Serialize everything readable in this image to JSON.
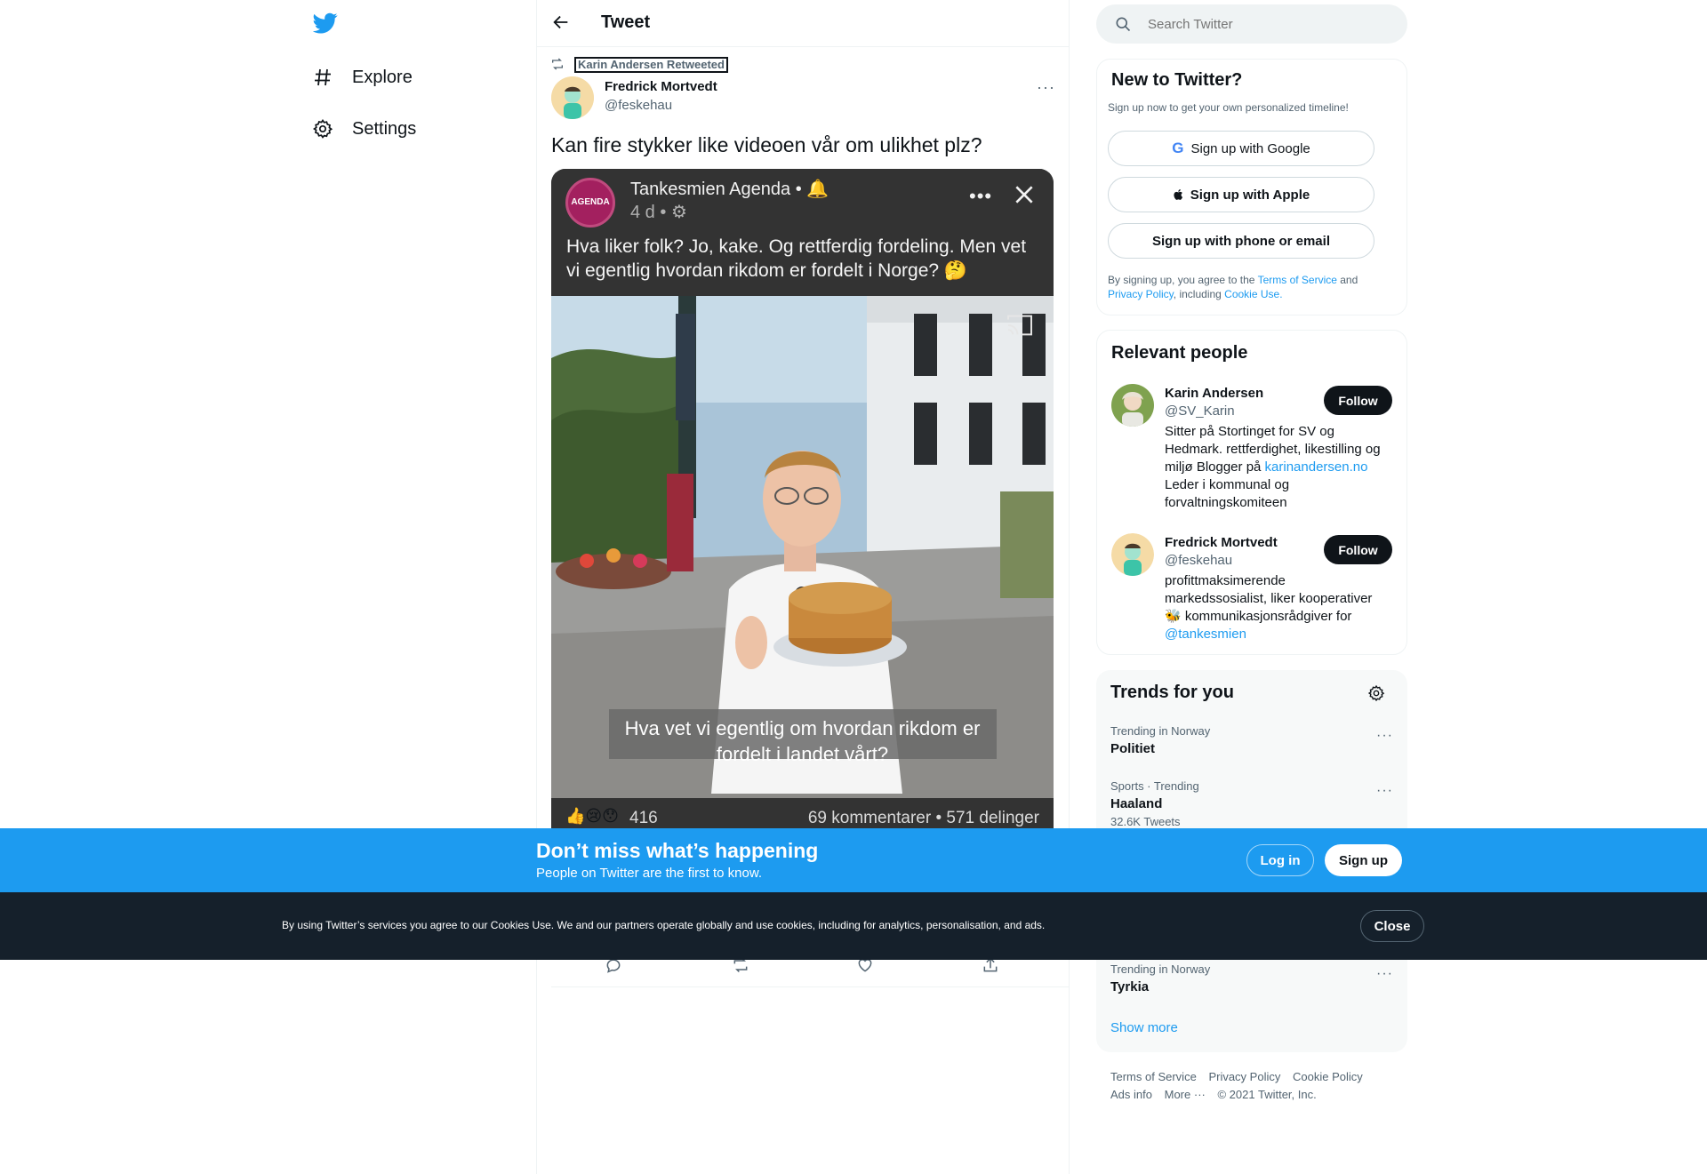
{
  "nav": {
    "explore_label": "Explore",
    "settings_label": "Settings"
  },
  "header": {
    "title": "Tweet"
  },
  "tweet": {
    "retweet_context": "Karin Andersen Retweeted",
    "author_name": "Fredrick Mortvedt",
    "author_handle": "@feskehau",
    "text": "Kan fire stykker like videoen vår om ulikhet plz?",
    "media": {
      "page_name": "Tankesmien Agenda",
      "page_meta_dot": "•",
      "avatar_label": "AGENDA",
      "time": "4 d",
      "post_text": "Hva liker folk? Jo, kake. Og rettferdig fordeling. Men vet vi egentlig hvordan rikdom er fordelt i Norge? 🤔",
      "caption": "Hva vet vi egentlig om hvordan rikdom er fordelt i landet vårt?",
      "reactions_count": "416",
      "comments_shares": "69 kommentarer • 571 delinger"
    }
  },
  "search": {
    "placeholder": "Search Twitter"
  },
  "new_to_twitter": {
    "title": "New to Twitter?",
    "subtitle": "Sign up now to get your own personalized timeline!",
    "google_label": "Sign up with Google",
    "apple_label": "Sign up with Apple",
    "phone_label": "Sign up with phone or email",
    "legal_prefix": "By signing up, you agree to the ",
    "terms_link": "Terms of Service",
    "legal_and": " and",
    "privacy_link": "Privacy Policy",
    "legal_including": ", including ",
    "cookie_link": "Cookie Use."
  },
  "relevant_people": {
    "title": "Relevant people",
    "people": [
      {
        "name": "Karin Andersen",
        "handle": "@SV_Karin",
        "follow_label": "Follow",
        "bio_before": "Sitter på Stortinget for SV og Hedmark. rettferdighet, likestilling og miljø Blogger på ",
        "bio_link": "karinandersen.no",
        "bio_after": " Leder i kommunal og forvaltningskomiteen"
      },
      {
        "name": "Fredrick Mortvedt",
        "handle": "@feskehau",
        "follow_label": "Follow",
        "bio_before": "profittmaksimerende markedssosialist, liker kooperativer 🐝 kommunikasjonsrådgiver for ",
        "bio_link": "@tankesmien",
        "bio_after": ""
      }
    ]
  },
  "trends": {
    "title": "Trends for you",
    "items": [
      {
        "context": "Trending in Norway",
        "name": "Politiet",
        "count": ""
      },
      {
        "context": "Sports · Trending",
        "name": "Haaland",
        "count": "32.6K Tweets"
      },
      {
        "context": "Trending in Norway",
        "name": "Tyrkia",
        "count": ""
      }
    ],
    "show_more": "Show more"
  },
  "footer": {
    "terms": "Terms of Service",
    "privacy": "Privacy Policy",
    "cookie": "Cookie Policy",
    "ads": "Ads info",
    "more": "More",
    "copyright": "© 2021 Twitter, Inc."
  },
  "signup_banner": {
    "title": "Don’t miss what’s happening",
    "subtitle": "People on Twitter are the first to know.",
    "login_label": "Log in",
    "signup_label": "Sign up"
  },
  "cookie_banner": {
    "text": "By using Twitter’s services you agree to our Cookies Use. We and our partners operate globally and use cookies, including for analytics, personalisation, and ads.",
    "close_label": "Close"
  },
  "colors": {
    "accent": "#1d9bf0",
    "text": "#0f1419",
    "secondary": "#536471",
    "dark_banner": "#15202b"
  }
}
